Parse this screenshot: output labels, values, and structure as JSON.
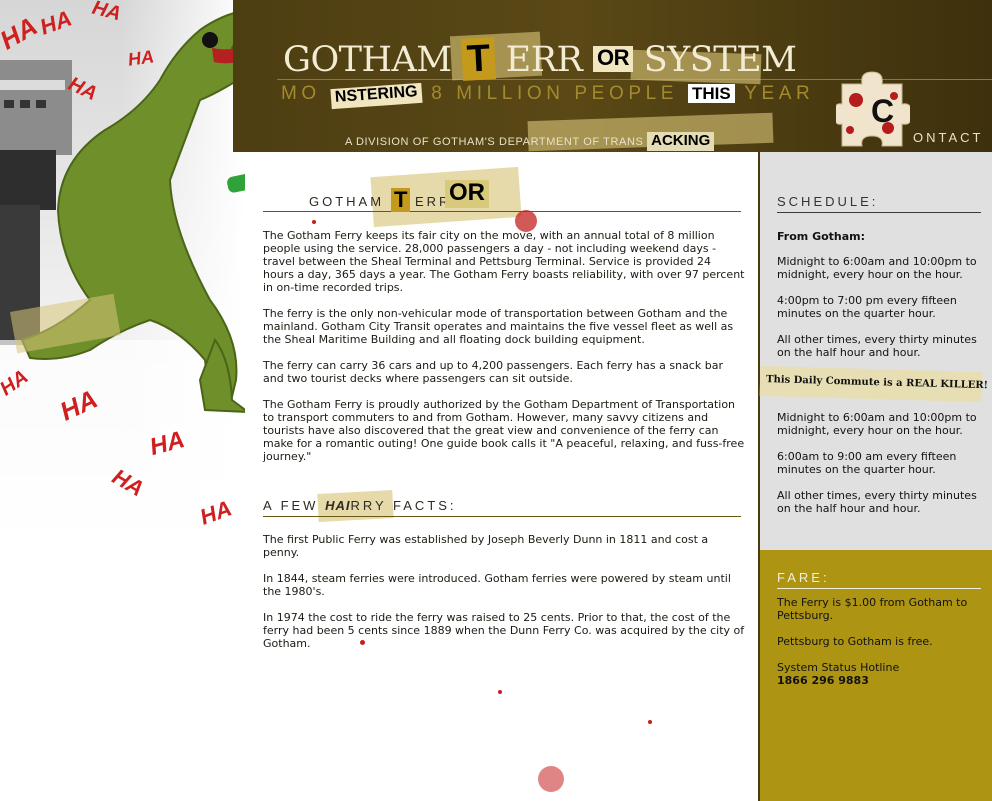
{
  "header": {
    "title_segments": [
      "GOTHAM",
      "T",
      "ERR",
      "OR",
      "SYSTEM"
    ],
    "tagline_segments": [
      "MO",
      "NSTERING",
      " 8 MILLION PEOPLE ",
      "THIS",
      " YEAR"
    ],
    "division_segments": [
      "A DIVISION OF GOTHAM'S DEPARTMENT OF TRANS",
      "ACKING"
    ],
    "contact_label": [
      "C",
      "ONTACT"
    ]
  },
  "main": {
    "section1": {
      "heading": [
        "GOTHAM",
        "T",
        "ERR",
        "OR"
      ],
      "paragraphs": [
        "The Gotham Ferry keeps its fair city on the move, with an annual total of 8 million people using the service. 28,000 passengers a day - not including weekend days - travel between the Sheal Terminal and Pettsburg Terminal. Service is provided 24 hours a day, 365 days a year. The Gotham Ferry boasts reliability, with over 97 percent in on-time recorded trips.",
        "The ferry is the only non-vehicular mode of transportation between Gotham and the mainland. Gotham City Transit operates and maintains the five vessel fleet as well as the Sheal Maritime Building and all floating dock building equipment.",
        "The ferry can carry 36 cars and up to 4,200 passengers. Each ferry has a snack bar and two tourist decks where passengers can sit outside.",
        "The Gotham Ferry is proudly authorized by the Gotham Department of Transportation to transport commuters to and from Gotham. However, many savvy citizens and tourists have also discovered that the great view and convenience of the ferry can make for a romantic outing! One guide book calls it \"A peaceful, relaxing, and fuss-free journey.\""
      ]
    },
    "section2": {
      "heading": [
        "A FEW ",
        "HAI",
        "RRY FACTS:"
      ],
      "paragraphs": [
        "The first Public Ferry was established by Joseph Beverly Dunn in 1811 and cost a penny.",
        "In 1844, steam ferries were introduced. Gotham ferries were powered by steam until the 1980's.",
        "In 1974 the cost to ride the ferry was raised to 25 cents. Prior to that, the cost of the ferry had been 5 cents since 1889 when the Dunn Ferry Co. was acquired by the city of Gotham."
      ]
    }
  },
  "sidebar": {
    "schedule": {
      "heading": "SCHEDULE:",
      "from_label": "From Gotham:",
      "items": [
        "Midnight to 6:00am and 10:00pm to midnight, every hour on the hour.",
        "4:00pm to 7:00 pm every fifteen minutes on the quarter hour.",
        "All other times, every thirty minutes on the half hour and hour.",
        "Midnight to 6:00am and 10:00pm to midnight, every hour on the hour.",
        "6:00am to 9:00 am every fifteen minutes on the quarter hour.",
        "All other times, every thirty minutes on the half hour and hour."
      ],
      "banner": "This Daily Commute is a REAL KILLER!"
    },
    "fare": {
      "heading": "FARE:",
      "items": [
        "The Ferry is $1.00 from Gotham to Pettsburg.",
        "Pettsburg to Gotham is free."
      ],
      "hotline_label": "System Status Hotline",
      "hotline_number": "1866 296 9883"
    }
  },
  "art": {
    "haha_text": "HA"
  },
  "colors": {
    "header_bg": "#4b3c10",
    "tagline": "#a48a2e",
    "sidebar_bg": "#e0e0e0",
    "fare_bg": "#ad9412",
    "blood_red": "#c42020"
  }
}
